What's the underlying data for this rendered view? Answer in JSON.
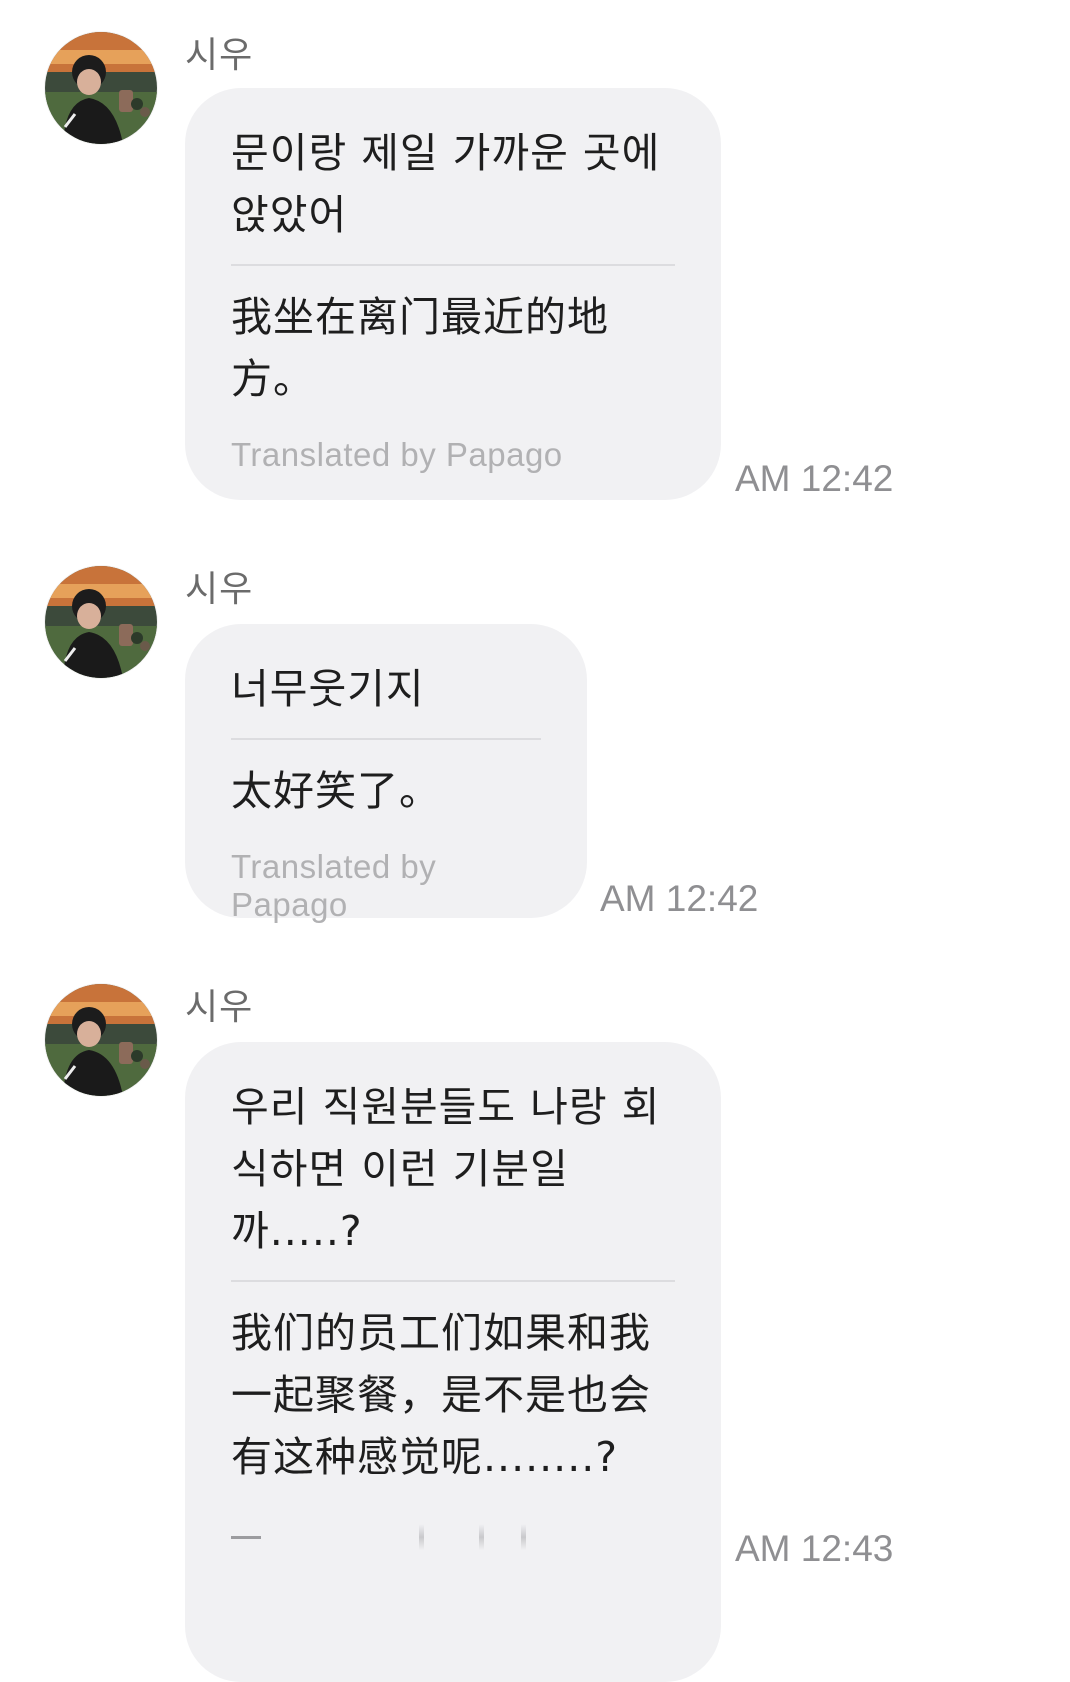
{
  "messages": [
    {
      "sender": "시우",
      "original": "문이랑 제일 가까운 곳에\n앉았어",
      "translation": "我坐在离门最近的地\n方。",
      "credit": "Translated by Papago",
      "time": "AM 12:42",
      "avatar_icon": "profile-photo"
    },
    {
      "sender": "시우",
      "original": "너무웃기지",
      "translation": "太好笑了。",
      "credit": "Translated by Papago",
      "time": "AM 12:42",
      "avatar_icon": "profile-photo"
    },
    {
      "sender": "시우",
      "original": "우리 직원분들도 나랑 회\n식하면 이런 기분일\n까.....?",
      "translation": "我们的员工们如果和我\n一起聚餐，是不是也会\n有这种感觉呢........?",
      "credit": "",
      "time": "AM 12:43",
      "avatar_icon": "profile-photo"
    }
  ],
  "colors": {
    "bubble_bg": "#f1f1f3",
    "divider": "#dcdcdf",
    "credit_text": "#b1b1b3",
    "time_text": "#8f8f92",
    "sender_text": "#6b6b6b"
  }
}
